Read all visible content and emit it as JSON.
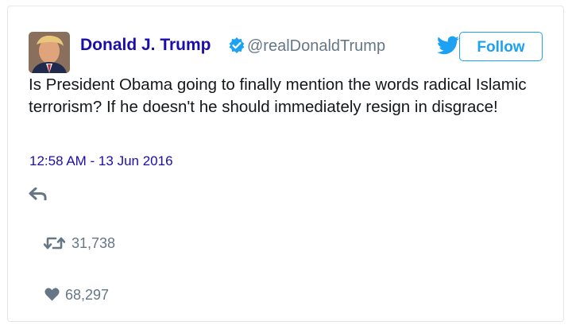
{
  "tweet": {
    "author_name": "Donald J. Trump",
    "author_handle": "@realDonaldTrump",
    "follow_label": "Follow",
    "text": "Is President Obama going to finally mention the words radical Islamic terrorism? If he doesn't he should immediately resign in disgrace!",
    "timestamp": "12:58 AM - 13 Jun 2016",
    "retweet_count": "31,738",
    "like_count": "68,297"
  },
  "icons": {
    "verified": "verified-badge-icon",
    "platform": "twitter-bird-icon",
    "reply": "reply-icon",
    "retweet": "retweet-icon",
    "like": "heart-icon"
  },
  "colors": {
    "name_link": "#1a0dab",
    "accent": "#1da1f2",
    "muted": "#657786",
    "text": "#14171a"
  }
}
